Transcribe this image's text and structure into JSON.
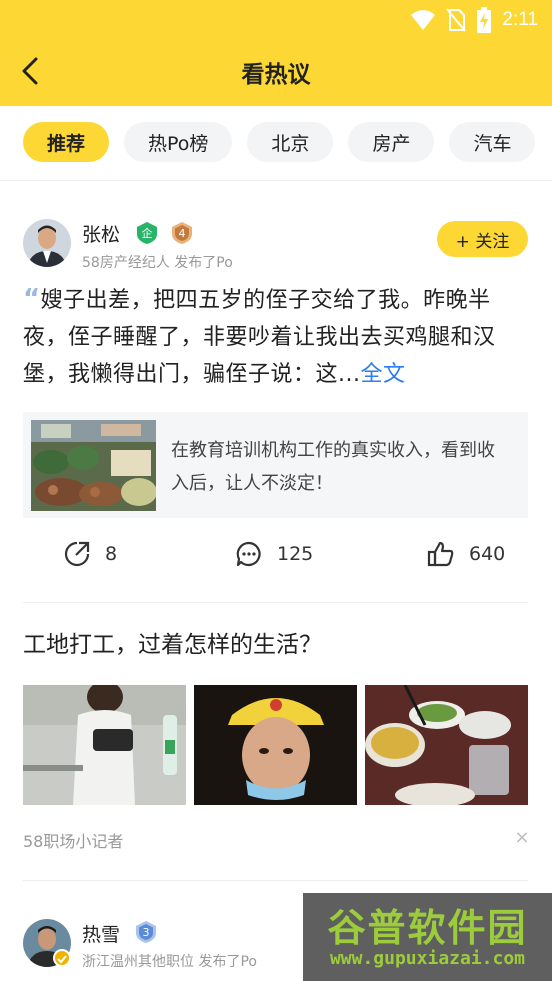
{
  "status_bar": {
    "time": "2:11"
  },
  "header": {
    "title": "看热议"
  },
  "tabs": [
    {
      "label": "推荐",
      "active": true
    },
    {
      "label": "热Po榜",
      "active": false
    },
    {
      "label": "北京",
      "active": false
    },
    {
      "label": "房产",
      "active": false
    },
    {
      "label": "汽车",
      "active": false
    }
  ],
  "post1": {
    "author": "张松",
    "enterprise_badge": "企",
    "level": "4",
    "meta": "58房产经纪人 发布了Po",
    "follow_label": "+ 关注",
    "quote": "“",
    "body": "嫂子出差，把四五岁的侄子交给了我。昨晚半夜，侄子睡醒了，非要吵着让我出去买鸡腿和汉堡，我懒得出门，骗侄子说：这...",
    "more": "全文",
    "link_card_text": "在教育培训机构工作的真实收入，看到收入后，让人不淡定！",
    "shares": "8",
    "comments": "125",
    "likes": "640"
  },
  "post2": {
    "title": "工地打工，过着怎样的生活？",
    "source": "58职场小记者",
    "close": "×"
  },
  "post3": {
    "author": "热雪",
    "level": "3",
    "meta": "浙江温州其他职位 发布了Po"
  },
  "watermark": {
    "title": "谷普软件园",
    "url": "www.gupuxiazai.com"
  },
  "colors": {
    "brand_yellow": "#fdd835",
    "link_blue": "#2a7df4",
    "muted": "#999999"
  }
}
